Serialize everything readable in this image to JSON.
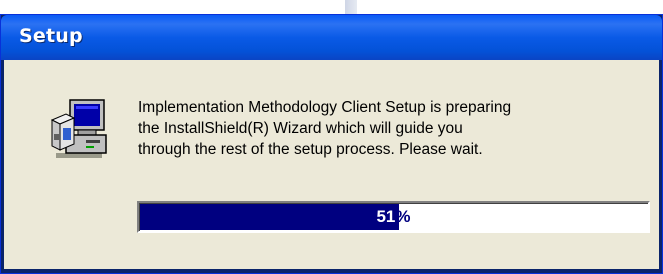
{
  "window": {
    "title": "Setup"
  },
  "dialog": {
    "icon": "setup-computer-icon",
    "message": "Implementation Methodology Client Setup is preparing\nthe InstallShield(R) Wizard which will guide you\nthrough the rest of the setup process.  Please wait.",
    "progress": {
      "value": 0.51,
      "number": "51",
      "sign": "%"
    }
  },
  "colors": {
    "titlebar": "#0a5ae6",
    "client_bg": "#ece9d8",
    "progress_fill": "#000080"
  }
}
